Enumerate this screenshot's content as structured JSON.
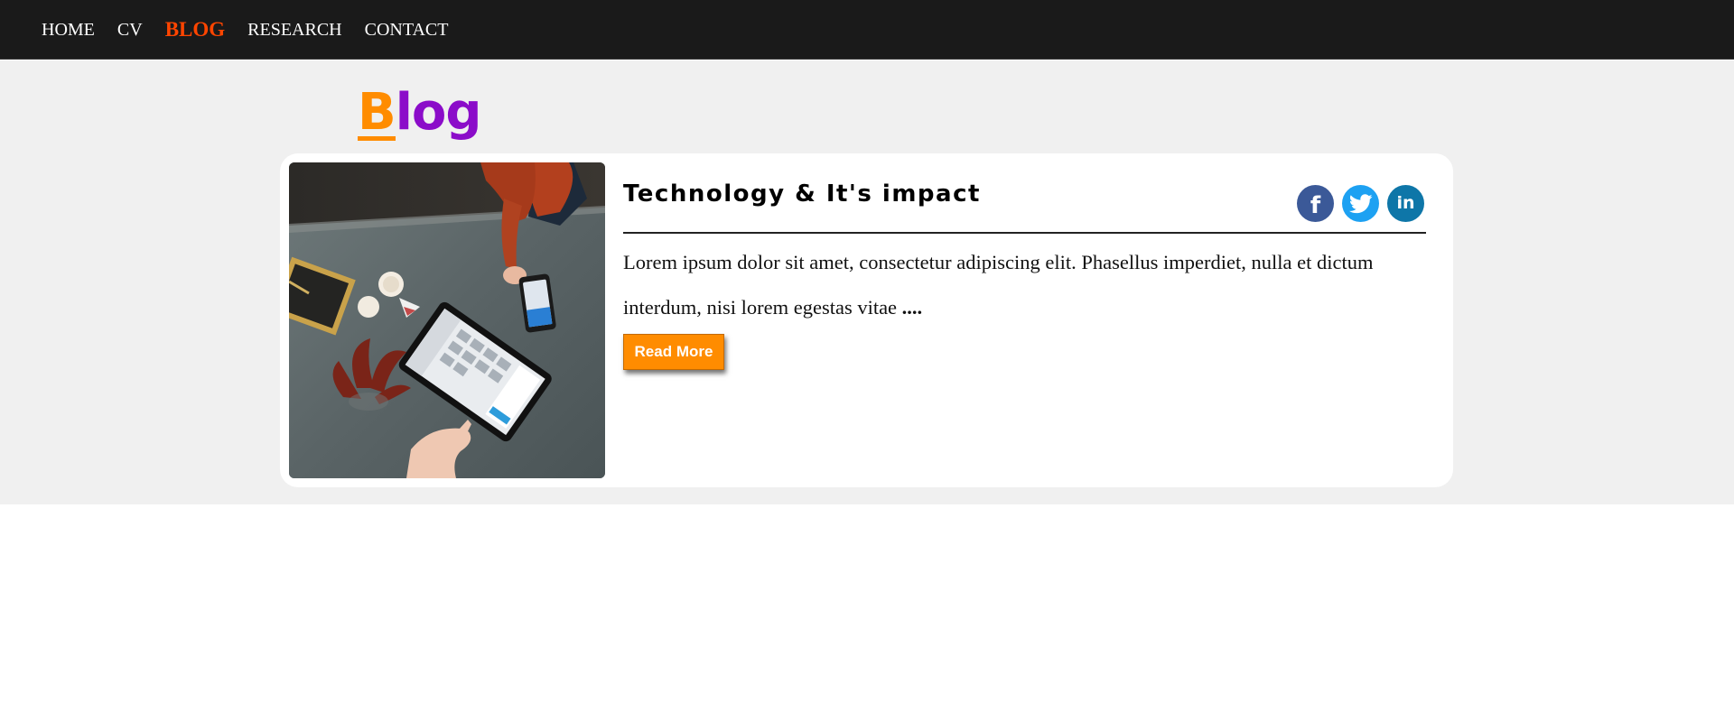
{
  "nav": {
    "items": [
      {
        "label": "HOME",
        "active": false
      },
      {
        "label": "CV",
        "active": false
      },
      {
        "label": "BLOG",
        "active": true
      },
      {
        "label": "RESEARCH",
        "active": false
      },
      {
        "label": "CONTACT",
        "active": false
      }
    ]
  },
  "page": {
    "heading_first": "B",
    "heading_rest": "log"
  },
  "post": {
    "title": "Technology & It's impact",
    "excerpt": "Lorem ipsum dolor sit amet, consectetur adipiscing elit. Phasellus imperdiet, nulla et dictum interdum, nisi lorem egestas vitae",
    "ellipsis": "....",
    "read_more_label": "Read More",
    "image_icon": "tablet-phone-photo"
  },
  "social": {
    "facebook_glyph": "f",
    "linkedin_glyph": "in",
    "icons": [
      "facebook-icon",
      "twitter-icon",
      "linkedin-icon"
    ]
  },
  "colors": {
    "accent_orange": "#ff8c00",
    "heading_purple": "#8b0cc9",
    "nav_active": "#ff4500",
    "nav_bg": "#1a1a1a",
    "band_bg": "#f0f0f0"
  }
}
